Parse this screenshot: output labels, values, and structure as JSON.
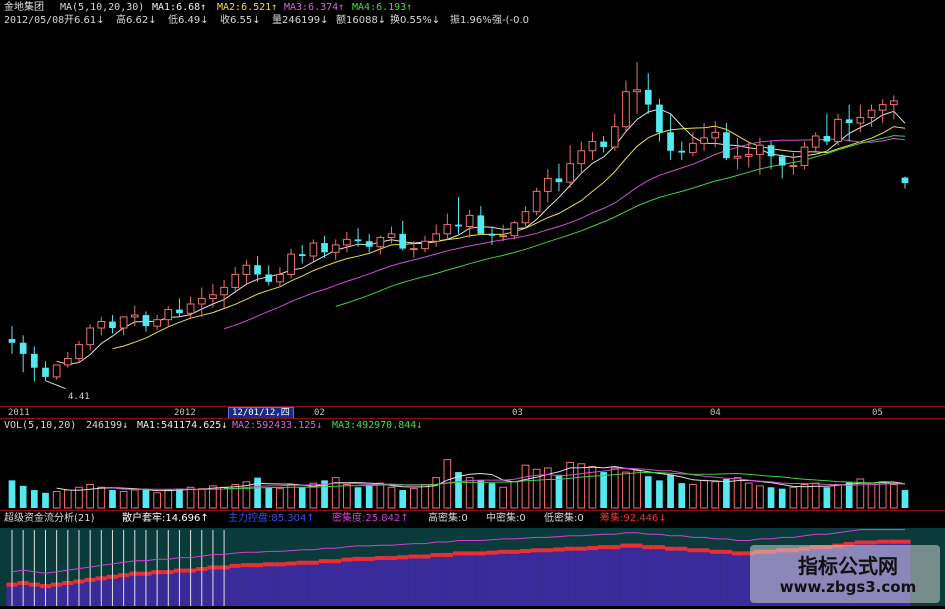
{
  "header": {
    "stock_name": "金地集团",
    "ma_label": "MA(5,10,20,30)",
    "ma1": "MA1:6.68↑",
    "ma2": "MA2:6.521↑",
    "ma3": "MA3:6.374↑",
    "ma4": "MA4:6.193↑",
    "date": "2012/05/08",
    "open": "开6.61↓",
    "high": "高6.62↓",
    "low": "低6.49↓",
    "close": "收6.55↓",
    "volume": "量246199↓",
    "amount": "额16088↓",
    "turnover": "换0.55%↓",
    "amplitude": "振1.96%",
    "strength": "强-(-0.0"
  },
  "colors": {
    "up_candle": "#f07070",
    "down_candle": "#54e8f0",
    "ma1": "#e0e0e0",
    "ma2": "#e8e040",
    "ma3": "#d050d0",
    "ma4": "#40d040",
    "axis_red": "#8b1010"
  },
  "annotations": {
    "low_price": "4.41"
  },
  "time_axis": {
    "labels": [
      "2011",
      "2012",
      "02",
      "03",
      "04",
      "05"
    ],
    "cursor_label": "12/01/12,四"
  },
  "vol_header": {
    "label": "VOL(5,10,20)",
    "value": "246199↓",
    "ma1": "MA1:541174.625↓",
    "ma2": "MA2:592433.125↓",
    "ma3": "MA3:492970.844↓"
  },
  "flow_header": {
    "title": "超级资金流分析(21)",
    "retail": "散户套牢:14.696↑",
    "main": "主力控盘:85.304↑",
    "density": "密集度:25.842↑",
    "high_dense": "高密集:0",
    "mid_dense": "中密集:0",
    "low_dense": "低密集:0",
    "chip": "筹集:92.446↓"
  },
  "watermark": {
    "title": "指标公式网",
    "url": "www.zbgs3.com"
  },
  "chart_data": [
    {
      "type": "candlestick",
      "title": "金地集团",
      "series": [
        {
          "name": "金地集团"
        }
      ],
      "x": [
        0,
        1,
        2,
        3,
        4,
        5,
        6,
        7,
        8,
        9,
        10,
        11,
        12,
        13,
        14,
        15,
        16,
        17,
        18,
        19,
        20,
        21,
        22,
        23,
        24,
        25,
        26,
        27,
        28,
        29,
        30,
        31,
        32,
        33,
        34,
        35,
        36,
        37,
        38,
        39,
        40,
        41,
        42,
        43,
        44,
        45,
        46,
        47,
        48,
        49,
        50,
        51,
        52,
        53,
        54,
        55,
        56,
        57,
        58,
        59,
        60,
        61,
        62,
        63,
        64,
        65,
        66,
        67,
        68,
        69,
        70,
        71,
        72,
        73,
        74,
        75,
        76,
        77,
        78,
        79,
        80
      ],
      "open": [
        4.86,
        4.82,
        4.7,
        4.55,
        4.45,
        4.58,
        4.65,
        4.8,
        4.98,
        5.05,
        4.98,
        5.1,
        5.12,
        5.0,
        5.07,
        5.18,
        5.14,
        5.24,
        5.3,
        5.34,
        5.42,
        5.56,
        5.66,
        5.56,
        5.48,
        5.56,
        5.78,
        5.76,
        5.9,
        5.8,
        5.88,
        5.94,
        5.92,
        5.86,
        5.96,
        6.0,
        5.84,
        5.84,
        5.92,
        6.0,
        6.1,
        6.08,
        6.2,
        6.0,
        5.98,
        5.98,
        6.12,
        6.24,
        6.46,
        6.6,
        6.56,
        6.76,
        6.9,
        7.0,
        6.94,
        7.16,
        7.54,
        7.56,
        7.4,
        7.1,
        6.9,
        6.88,
        6.98,
        7.04,
        7.1,
        6.82,
        6.84,
        6.86,
        6.96,
        6.84,
        6.74,
        6.74,
        6.94,
        7.06,
        7.0,
        7.24,
        7.2,
        7.26,
        7.34,
        7.4,
        6.61
      ],
      "high": [
        5.0,
        4.9,
        4.78,
        4.62,
        4.58,
        4.72,
        4.84,
        5.02,
        5.1,
        5.12,
        5.1,
        5.22,
        5.16,
        5.12,
        5.22,
        5.3,
        5.32,
        5.42,
        5.46,
        5.5,
        5.64,
        5.72,
        5.76,
        5.66,
        5.64,
        5.84,
        5.88,
        5.94,
        5.98,
        5.94,
        6.02,
        6.06,
        6.0,
        5.98,
        6.08,
        6.14,
        5.92,
        5.98,
        6.1,
        6.22,
        6.4,
        6.26,
        6.3,
        6.08,
        6.1,
        6.14,
        6.3,
        6.5,
        6.7,
        6.76,
        6.96,
        7.0,
        7.1,
        7.06,
        7.3,
        7.66,
        7.86,
        7.74,
        7.46,
        7.3,
        7.0,
        7.1,
        7.2,
        7.22,
        7.2,
        7.04,
        7.0,
        7.04,
        7.0,
        6.86,
        6.88,
        7.0,
        7.1,
        7.3,
        7.3,
        7.4,
        7.4,
        7.4,
        7.46,
        7.5,
        6.62
      ],
      "low": [
        4.7,
        4.5,
        4.4,
        4.41,
        4.42,
        4.55,
        4.6,
        4.74,
        4.9,
        4.92,
        4.9,
        5.0,
        4.94,
        4.96,
        5.0,
        5.1,
        5.08,
        5.1,
        5.2,
        5.2,
        5.36,
        5.46,
        5.48,
        5.44,
        5.42,
        5.52,
        5.68,
        5.7,
        5.74,
        5.72,
        5.8,
        5.86,
        5.8,
        5.78,
        5.9,
        5.82,
        5.74,
        5.8,
        5.86,
        5.94,
        6.0,
        5.96,
        6.0,
        5.88,
        5.92,
        5.94,
        6.08,
        6.2,
        6.34,
        6.46,
        6.5,
        6.66,
        6.8,
        6.88,
        6.9,
        7.1,
        7.3,
        7.3,
        7.0,
        6.8,
        6.8,
        6.84,
        6.9,
        6.94,
        6.8,
        6.7,
        6.72,
        6.64,
        6.7,
        6.6,
        6.64,
        6.7,
        6.88,
        6.96,
        6.96,
        7.0,
        7.1,
        7.16,
        7.2,
        7.24,
        6.49
      ],
      "close": [
        4.82,
        4.7,
        4.55,
        4.45,
        4.58,
        4.65,
        4.8,
        4.98,
        5.05,
        4.98,
        5.1,
        5.12,
        5.0,
        5.07,
        5.18,
        5.14,
        5.24,
        5.3,
        5.34,
        5.42,
        5.56,
        5.66,
        5.56,
        5.48,
        5.56,
        5.78,
        5.76,
        5.9,
        5.8,
        5.88,
        5.94,
        5.92,
        5.86,
        5.96,
        6.0,
        5.84,
        5.84,
        5.92,
        6.0,
        6.1,
        6.08,
        6.2,
        6.0,
        5.98,
        5.98,
        6.12,
        6.24,
        6.46,
        6.6,
        6.56,
        6.76,
        6.9,
        7.0,
        6.94,
        7.16,
        7.54,
        7.56,
        7.4,
        7.1,
        6.9,
        6.88,
        6.98,
        7.04,
        7.1,
        6.82,
        6.84,
        6.86,
        6.96,
        6.84,
        6.74,
        6.74,
        6.94,
        7.06,
        7.0,
        7.24,
        7.2,
        7.26,
        7.34,
        7.4,
        7.44,
        6.55
      ],
      "ylim": [
        4.2,
        8.1
      ]
    },
    {
      "type": "bar",
      "title": "VOL(5,10,20)",
      "series": [
        {
          "name": "VOL"
        }
      ],
      "values": [
        40,
        32,
        26,
        22,
        24,
        26,
        30,
        34,
        30,
        26,
        24,
        26,
        28,
        22,
        26,
        28,
        30,
        28,
        32,
        30,
        34,
        38,
        44,
        30,
        28,
        34,
        30,
        36,
        40,
        44,
        34,
        30,
        32,
        36,
        30,
        26,
        28,
        34,
        44,
        70,
        52,
        44,
        40,
        36,
        30,
        38,
        62,
        56,
        58,
        48,
        66,
        64,
        60,
        52,
        58,
        52,
        54,
        46,
        40,
        48,
        36,
        34,
        40,
        38,
        42,
        44,
        36,
        32,
        30,
        28,
        30,
        34,
        36,
        30,
        34,
        38,
        42,
        36,
        38,
        34,
        26
      ],
      "ylim": [
        0,
        110
      ]
    },
    {
      "type": "bar",
      "title": "超级资金流分析(21)",
      "series": [
        {
          "name": "主力控盘"
        }
      ],
      "values": [
        30,
        32,
        30,
        28,
        30,
        32,
        34,
        36,
        38,
        40,
        42,
        44,
        44,
        46,
        46,
        48,
        48,
        50,
        52,
        52,
        54,
        55,
        55,
        56,
        56,
        57,
        58,
        58,
        60,
        60,
        62,
        63,
        63,
        64,
        64,
        65,
        66,
        66,
        68,
        68,
        70,
        70,
        70,
        71,
        72,
        72,
        73,
        74,
        74,
        75,
        76,
        76,
        77,
        78,
        78,
        80,
        80,
        78,
        78,
        76,
        76,
        74,
        74,
        72,
        72,
        70,
        70,
        72,
        72,
        74,
        74,
        76,
        78,
        78,
        80,
        82,
        84,
        84,
        85,
        85,
        85
      ],
      "ylim": [
        0,
        100
      ]
    }
  ]
}
